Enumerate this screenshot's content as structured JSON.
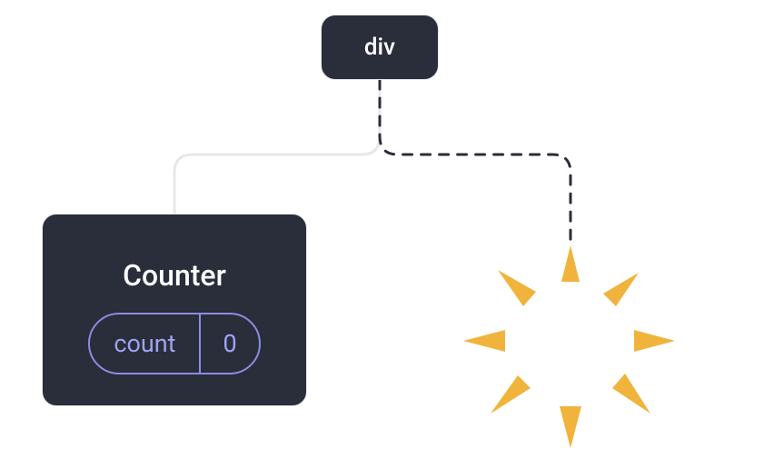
{
  "root": {
    "label": "div"
  },
  "counter": {
    "title": "Counter",
    "state": {
      "label": "count",
      "value": "0"
    }
  },
  "edges": {
    "left": "solid",
    "right": "dashed"
  },
  "burst": {
    "color": "#f0b43c"
  }
}
